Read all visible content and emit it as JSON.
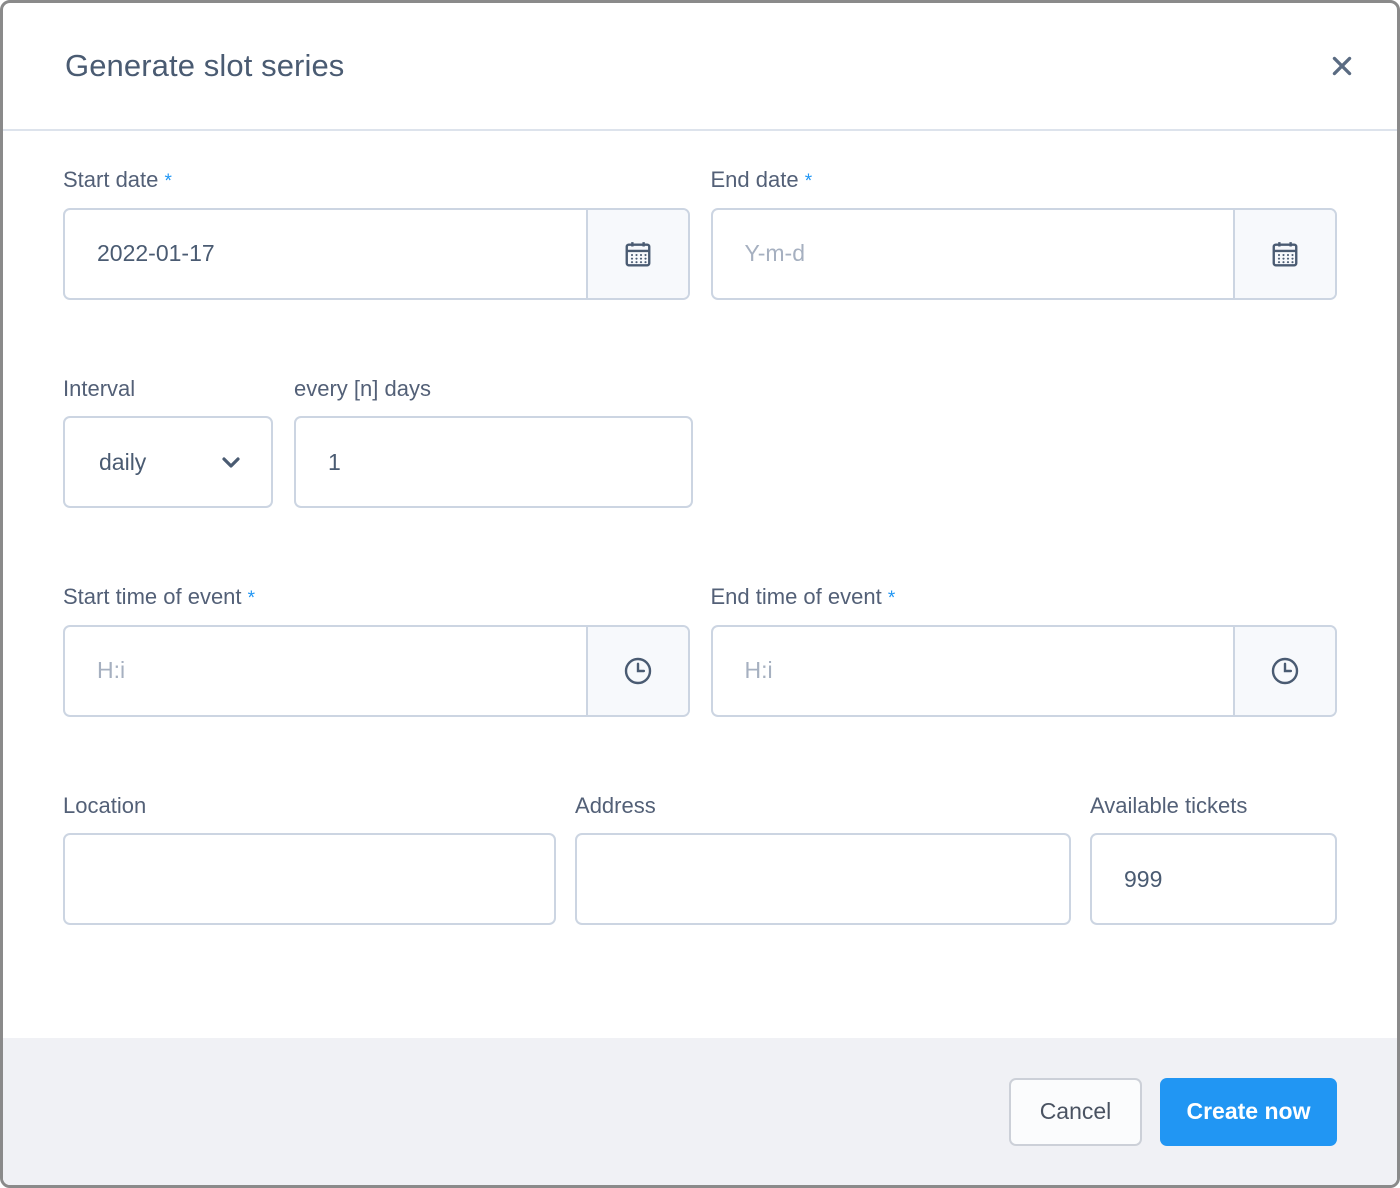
{
  "dialog": {
    "title": "Generate slot series",
    "close_icon": "close-icon"
  },
  "fields": {
    "start_date": {
      "label": "Start date",
      "required_marker": "*",
      "value": "2022-01-17",
      "placeholder": "Y-m-d",
      "addon_icon": "calendar-icon"
    },
    "end_date": {
      "label": "End date",
      "required_marker": "*",
      "value": "",
      "placeholder": "Y-m-d",
      "addon_icon": "calendar-icon"
    },
    "interval": {
      "label": "Interval",
      "value": "daily",
      "options": [
        "daily"
      ],
      "chevron_icon": "chevron-down-icon"
    },
    "every_n_days": {
      "label": "every [n] days",
      "value": "1",
      "placeholder": ""
    },
    "start_time": {
      "label": "Start time of event",
      "required_marker": "*",
      "value": "",
      "placeholder": "H:i",
      "addon_icon": "clock-icon"
    },
    "end_time": {
      "label": "End time of event",
      "required_marker": "*",
      "value": "",
      "placeholder": "H:i",
      "addon_icon": "clock-icon"
    },
    "location": {
      "label": "Location",
      "value": "",
      "placeholder": ""
    },
    "address": {
      "label": "Address",
      "value": "",
      "placeholder": ""
    },
    "available_tickets": {
      "label": "Available tickets",
      "value": "999",
      "placeholder": ""
    }
  },
  "footer": {
    "cancel_label": "Cancel",
    "create_label": "Create now"
  },
  "colors": {
    "accent": "#2196f3",
    "required_star": "#2196f3",
    "label_text": "#536077",
    "input_text": "#4a5b72",
    "placeholder_text": "#a6b0c0",
    "border": "#ccd5e2",
    "footer_bg": "#f0f1f5",
    "addon_bg": "#f7f9fc"
  }
}
